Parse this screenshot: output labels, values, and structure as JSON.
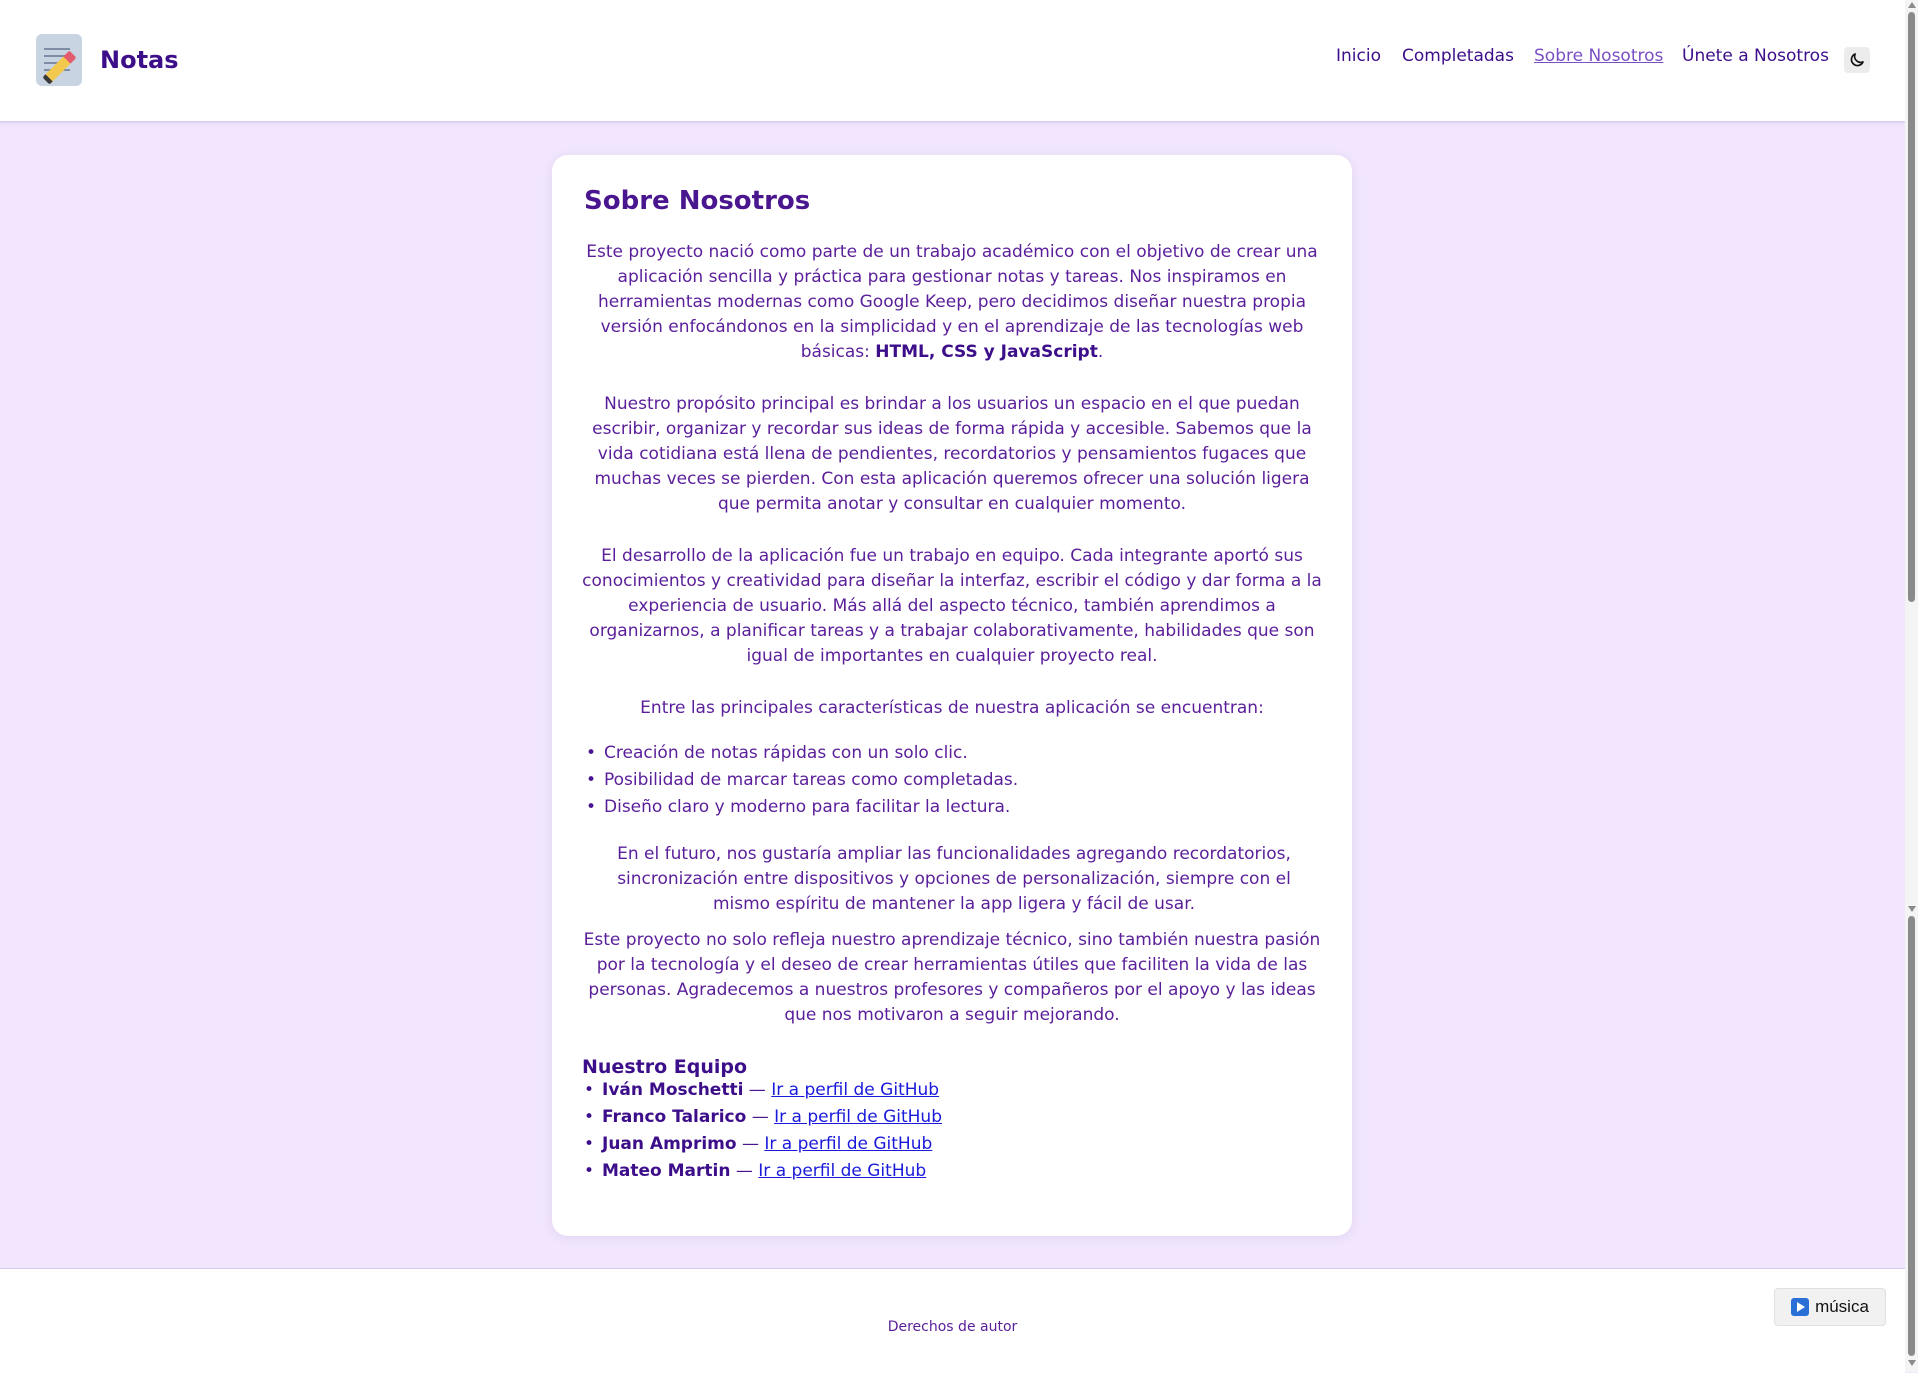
{
  "header": {
    "brand": "Notas",
    "nav": [
      {
        "label": "Inicio"
      },
      {
        "label": "Completadas"
      },
      {
        "label": "Sobre Nosotros"
      },
      {
        "label": "Únete a Nosotros"
      }
    ],
    "theme_icon": "moon-icon"
  },
  "main": {
    "title": "Sobre Nosotros",
    "p1_a": "Este proyecto nació como parte de un trabajo académico con el objetivo de crear una aplicación sencilla y práctica para gestionar notas y tareas. Nos inspiramos en herramientas modernas como Google Keep, pero decidimos diseñar nuestra propia versión enfocándonos en la simplicidad y en el aprendizaje de las tecnologías web básicas: ",
    "p1_strong": "HTML, CSS y JavaScript",
    "p1_end": ".",
    "p2": "Nuestro propósito principal es brindar a los usuarios un espacio en el que puedan escribir, organizar y recordar sus ideas de forma rápida y accesible. Sabemos que la vida cotidiana está llena de pendientes, recordatorios y pensamientos fugaces que muchas veces se pierden. Con esta aplicación queremos ofrecer una solución ligera que permita anotar y consultar en cualquier momento.",
    "p3": "El desarrollo de la aplicación fue un trabajo en equipo. Cada integrante aportó sus conocimientos y creatividad para diseñar la interfaz, escribir el código y dar forma a la experiencia de usuario. Más allá del aspecto técnico, también aprendimos a organizarnos, a planificar tareas y a trabajar colaborativamente, habilidades que son igual de importantes en cualquier proyecto real.",
    "p4": "Entre las principales características de nuestra aplicación se encuentran:",
    "features": [
      "Creación de notas rápidas con un solo clic.",
      "Posibilidad de marcar tareas como completadas.",
      "Diseño claro y moderno para facilitar la lectura."
    ],
    "p5": "En el futuro, nos gustaría ampliar las funcionalidades agregando recordatorios, sincronización entre dispositivos y opciones de personalización, siempre con el mismo espíritu de mantener la app ligera y fácil de usar.",
    "p6": "Este proyecto no solo refleja nuestro aprendizaje técnico, sino también nuestra pasión por la tecnología y el deseo de crear herramientas útiles que faciliten la vida de las personas. Agradecemos a nuestros profesores y compañeros por el apoyo y las ideas que nos motivaron a seguir mejorando.",
    "team_title": "Nuestro Equipo",
    "team_sep": " — ",
    "team": [
      {
        "name": "Iván Moschetti",
        "link": "Ir a perfil de GitHub"
      },
      {
        "name": "Franco Talarico",
        "link": "Ir a perfil de GitHub"
      },
      {
        "name": "Juan Amprimo",
        "link": "Ir a perfil de GitHub"
      },
      {
        "name": "Mateo Martin",
        "link": "Ir a perfil de GitHub"
      }
    ]
  },
  "footer": {
    "copyright": "Derechos de autor",
    "music_label": "música",
    "music_icon": "play-icon"
  },
  "colors": {
    "page_bg": "#f1e6fd",
    "primary_text": "#3d0e8a",
    "link": "#1a1adb"
  }
}
